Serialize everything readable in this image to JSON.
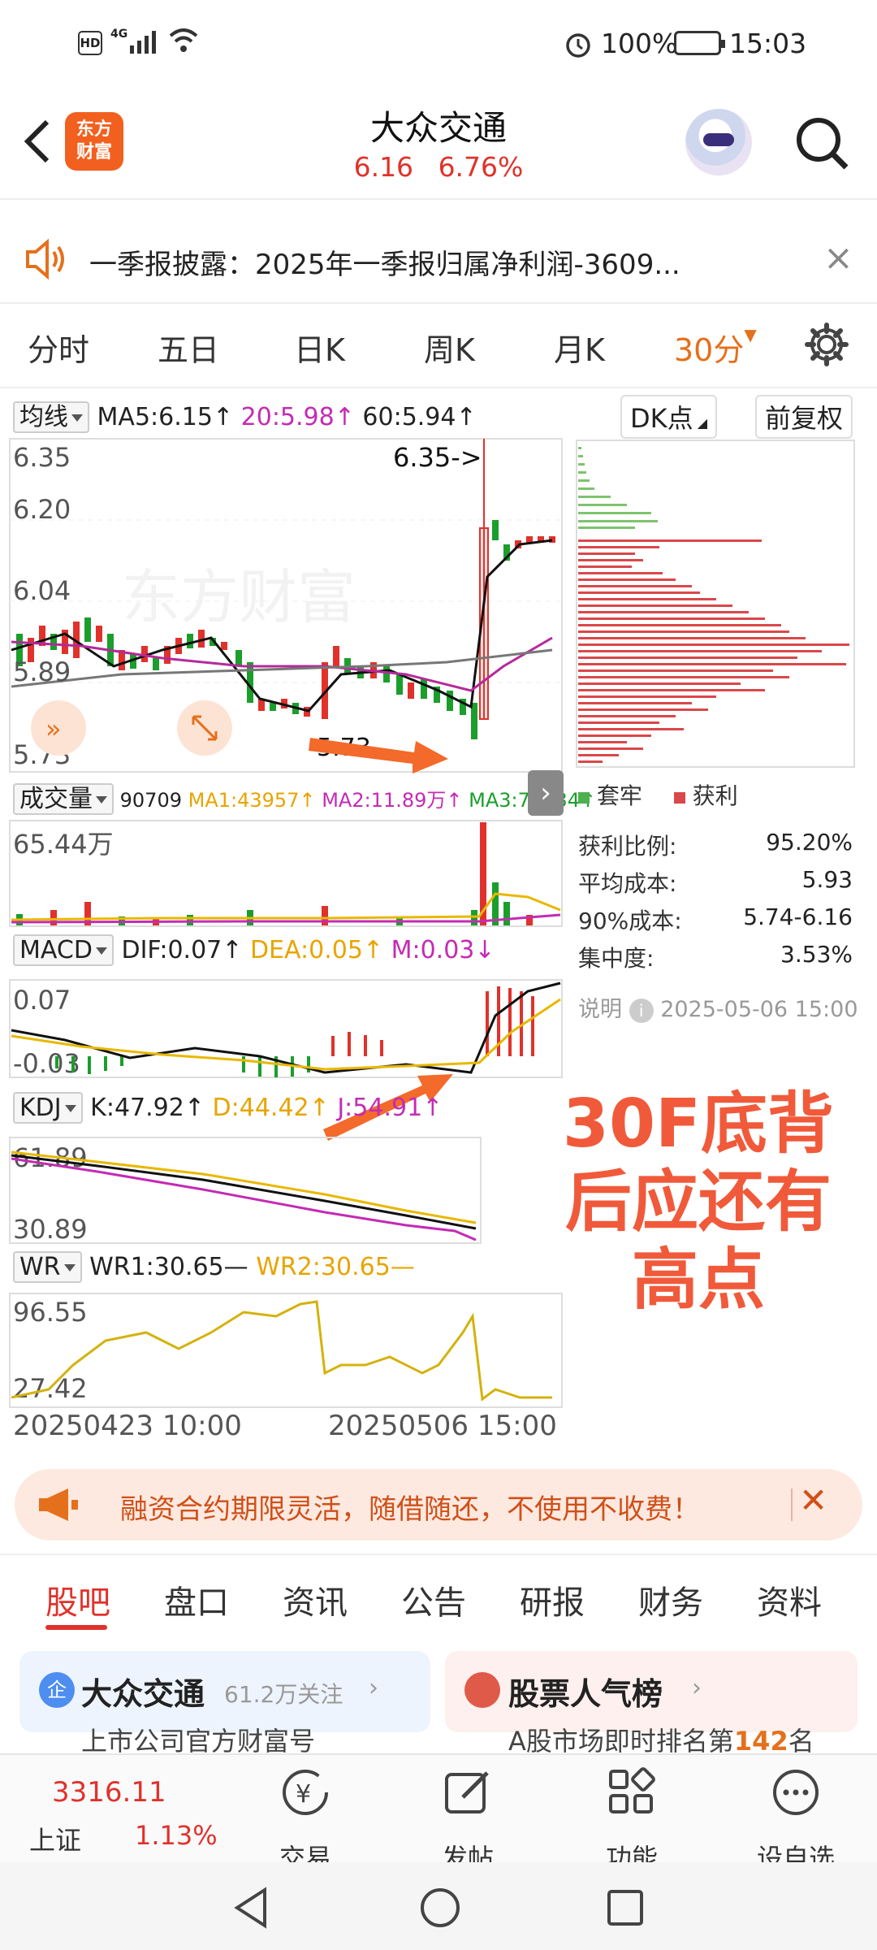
{
  "status_bar": {
    "hd": "HD",
    "signal": "4G",
    "battery": "100%",
    "time": "15:03"
  },
  "header": {
    "logo": [
      "东方",
      "财富"
    ],
    "title": "大众交通",
    "price": "6.16",
    "change_pct": "6.76%"
  },
  "notice": {
    "text": "一季报披露：2025年一季报归属净利润-3609...",
    "close": "×"
  },
  "period_tabs": [
    "分时",
    "五日",
    "日K",
    "周K",
    "月K",
    "30分"
  ],
  "period_active": "30分",
  "ma_row": {
    "selector": "均线",
    "ma5": "MA5:6.15↑",
    "ma20": "20:5.98↑",
    "ma60": "60:5.94↑",
    "dk_button": "DK点",
    "fq_button": "前复权"
  },
  "kline": {
    "y_labels": [
      "6.35",
      "6.20",
      "6.04",
      "5.89",
      "5.73"
    ],
    "high_marker": "6.35->",
    "low_marker": "5.73",
    "watermark": "东方财富"
  },
  "volume_row": {
    "selector": "成交量",
    "vol": "90709",
    "ma1": "MA1:43957↑",
    "ma2": "MA2:11.89万↑",
    "ma3": "MA3:73934↑",
    "y_label": "65.44万"
  },
  "chips": {
    "legend_trap": "套牢",
    "legend_profit": "获利",
    "stats": [
      {
        "label": "获利比例:",
        "value": "95.20%"
      },
      {
        "label": "平均成本:",
        "value": "5.93"
      },
      {
        "label": "90%成本:",
        "value": "5.74-6.16"
      },
      {
        "label": "集中度:",
        "value": "3.53%"
      }
    ],
    "note_label": "说明",
    "note_time": "2025-05-06 15:00"
  },
  "macd_row": {
    "selector": "MACD",
    "dif": "DIF:0.07↑",
    "dea": "DEA:0.05↑",
    "m": "M:0.03↓",
    "y_top": "0.07",
    "y_bottom": "-0.03"
  },
  "kdj_row": {
    "selector": "KDJ",
    "k": "K:47.92↑",
    "d": "D:44.42↑",
    "j": "J:54.91↑",
    "y_top": "61.89",
    "y_bottom": "30.89"
  },
  "wr_row": {
    "selector": "WR",
    "wr1": "WR1:30.65—",
    "wr2": "WR2:30.65—",
    "y_top": "96.55",
    "y_bottom": "27.42"
  },
  "x_axis": {
    "start": "20250423 10:00",
    "end": "20250506 15:00"
  },
  "annotation": [
    "30F底背",
    "后应还有",
    "高点"
  ],
  "promo": {
    "text": "融资合约期限灵活，随借随还，不使用不收费！",
    "close": "✕"
  },
  "bottom_tabs": [
    "股吧",
    "盘口",
    "资讯",
    "公告",
    "研报",
    "财务",
    "资料"
  ],
  "cards": {
    "left_title": "大众交通",
    "left_follow": "61.2万关注",
    "left_sub": "上市公司官方财富号",
    "left_badge": "企",
    "right_title": "股票人气榜",
    "right_sub_pre": "A股市场即时排名第",
    "right_rank": "142",
    "right_sub_post": "名"
  },
  "bottom_nav": {
    "index_value": "3316.11",
    "index_name": "上证",
    "index_pct": "1.13%",
    "items": [
      "交易",
      "发帖",
      "功能",
      "设自选"
    ]
  }
}
